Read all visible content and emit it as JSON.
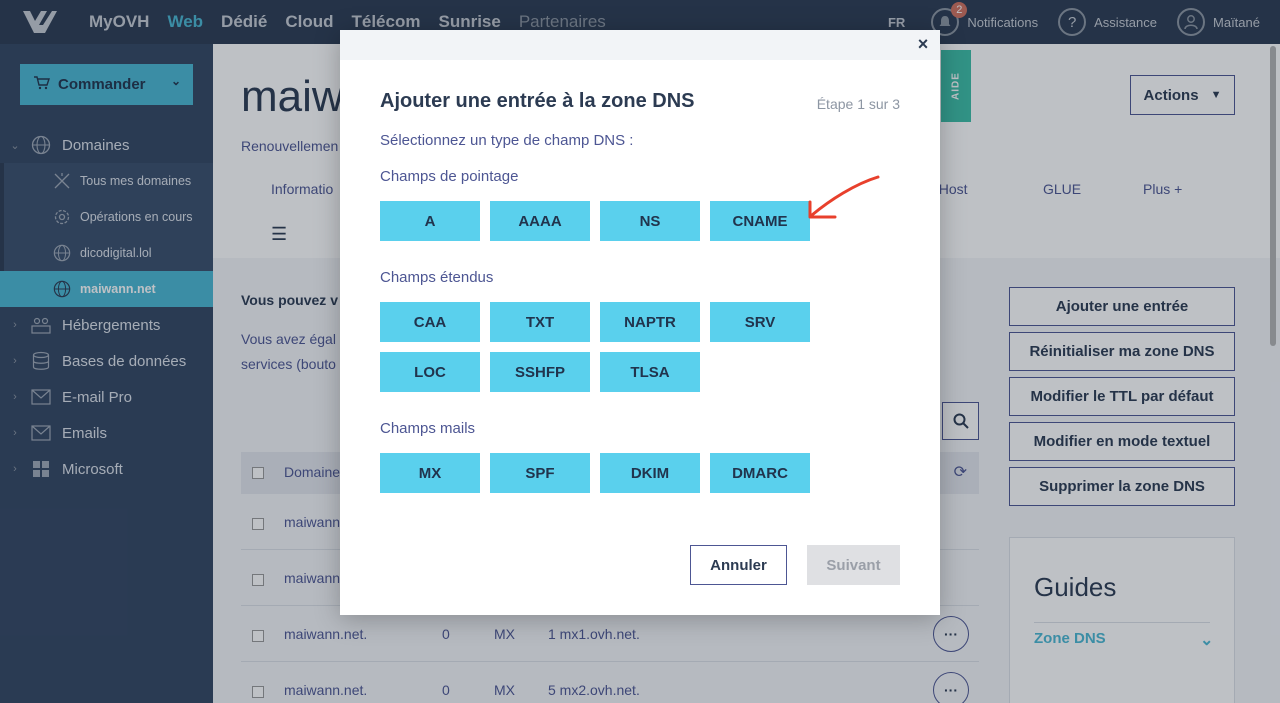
{
  "topbar": {
    "nav": [
      "MyOVH",
      "Web",
      "Dédié",
      "Cloud",
      "Télécom",
      "Sunrise",
      "Partenaires"
    ],
    "active_index": 1,
    "lang": "FR",
    "notifications_label": "Notifications",
    "notifications_count": "2",
    "help_label": "Assistance",
    "user_label": "Maïtané"
  },
  "sidebar": {
    "order_label": "Commander",
    "items": [
      {
        "label": "Domaines",
        "icon": "globe-icon"
      },
      {
        "label": "Tous mes domaines",
        "icon": "network-icon"
      },
      {
        "label": "Opérations en cours",
        "icon": "gear-icon"
      },
      {
        "label": "dicodigital.lol",
        "icon": "globe-icon"
      },
      {
        "label": "maiwann.net",
        "icon": "globe-icon"
      },
      {
        "label": "Hébergements",
        "icon": "users-icon"
      },
      {
        "label": "Bases de données",
        "icon": "database-icon"
      },
      {
        "label": "E-mail Pro",
        "icon": "mail-icon"
      },
      {
        "label": "Emails",
        "icon": "mail-icon"
      },
      {
        "label": "Microsoft",
        "icon": "windows-icon"
      }
    ]
  },
  "main": {
    "title": "maiw",
    "renew": "Renouvellemen",
    "tab_info": "Informatio",
    "tab_host": "nHost",
    "tab_glue": "GLUE",
    "tab_more": "Plus +",
    "aide": "AIDE",
    "actions_label": "Actions",
    "notice_bold": "Vous pouvez v",
    "notice_line1": "Vous avez égal",
    "notice_line2": "services (bouto",
    "table_header": "Domaine",
    "rows": [
      {
        "domain": "maiwann.",
        "ttl": "",
        "type": "",
        "target": ""
      },
      {
        "domain": "maiwann",
        "ttl": "",
        "type": "",
        "target": ""
      },
      {
        "domain": "maiwann.net.",
        "ttl": "0",
        "type": "MX",
        "target": "1 mx1.ovh.net."
      },
      {
        "domain": "maiwann.net.",
        "ttl": "0",
        "type": "MX",
        "target": "5 mx2.ovh.net."
      }
    ],
    "right_buttons": [
      "Ajouter une entrée",
      "Réinitialiser ma zone DNS",
      "Modifier le TTL par défaut",
      "Modifier en mode textuel",
      "Supprimer la zone DNS"
    ],
    "guides_title": "Guides",
    "guides_link": "Zone DNS"
  },
  "modal": {
    "title": "Ajouter une entrée à la zone DNS",
    "step": "Étape 1 sur 3",
    "subtitle": "Sélectionnez un type de champ DNS :",
    "groups": [
      {
        "title": "Champs de pointage",
        "types": [
          "A",
          "AAAA",
          "NS",
          "CNAME"
        ]
      },
      {
        "title": "Champs étendus",
        "types": [
          "CAA",
          "TXT",
          "NAPTR",
          "SRV",
          "LOC",
          "SSHFP",
          "TLSA"
        ]
      },
      {
        "title": "Champs mails",
        "types": [
          "MX",
          "SPF",
          "DKIM",
          "DMARC"
        ]
      }
    ],
    "cancel_label": "Annuler",
    "next_label": "Suivant",
    "close_label": "×"
  },
  "colors": {
    "accent": "#5ad0ed",
    "nav_bg": "#2c3b52",
    "sidebar_bg": "#334662",
    "annotation": "#e8402c"
  }
}
